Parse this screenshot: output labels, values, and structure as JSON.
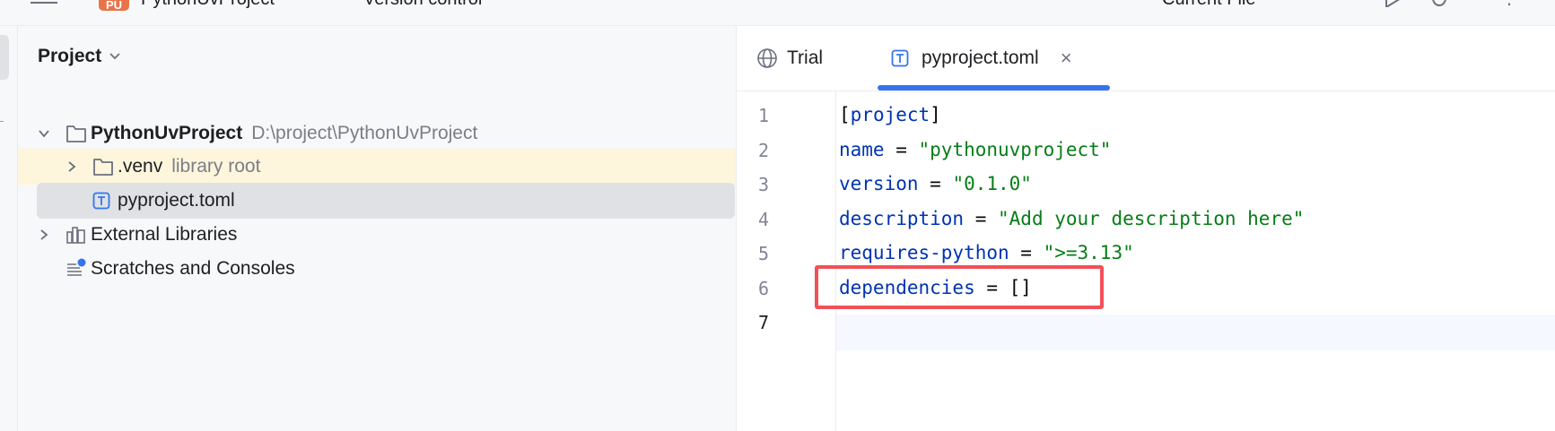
{
  "topbar": {
    "project_badge": "PU",
    "project_name": "PythonUvProject",
    "vcs_label": "Version control",
    "run_config": "Current File",
    "icons": [
      "hamburger-menu-icon",
      "run-icon",
      "debug-icon",
      "more-icon"
    ]
  },
  "project_panel": {
    "title": "Project",
    "tree": [
      {
        "name": "PythonUvProject",
        "hint": "D:\\project\\PythonUvProject",
        "type": "folder",
        "expanded": true
      },
      {
        "name": ".venv",
        "hint": "library root",
        "type": "folder",
        "expanded": false,
        "excluded": true
      },
      {
        "name": "pyproject.toml",
        "type": "toml-file",
        "selected": true
      },
      {
        "name": "External Libraries",
        "type": "libraries",
        "expanded": false
      },
      {
        "name": "Scratches and Consoles",
        "type": "scratches"
      }
    ]
  },
  "editor": {
    "tabs": [
      {
        "label": "Trial",
        "icon": "globe-icon",
        "active": false
      },
      {
        "label": "pyproject.toml",
        "icon": "toml-file-icon",
        "active": true,
        "close": "×"
      }
    ],
    "lines": [
      {
        "no": "1",
        "parts": [
          {
            "t": "[",
            "c": "p"
          },
          {
            "t": "project",
            "c": "k"
          },
          {
            "t": "]",
            "c": "p"
          }
        ]
      },
      {
        "no": "2",
        "parts": [
          {
            "t": "name",
            "c": "k"
          },
          {
            "t": " = ",
            "c": "p"
          },
          {
            "t": "\"pythonuvproject\"",
            "c": "s"
          }
        ]
      },
      {
        "no": "3",
        "parts": [
          {
            "t": "version",
            "c": "k"
          },
          {
            "t": " = ",
            "c": "p"
          },
          {
            "t": "\"0.1.0\"",
            "c": "s"
          }
        ]
      },
      {
        "no": "4",
        "parts": [
          {
            "t": "description",
            "c": "k"
          },
          {
            "t": " = ",
            "c": "p"
          },
          {
            "t": "\"Add your description here\"",
            "c": "s"
          }
        ]
      },
      {
        "no": "5",
        "parts": [
          {
            "t": "requires-python",
            "c": "k"
          },
          {
            "t": " = ",
            "c": "p"
          },
          {
            "t": "\">=3.13\"",
            "c": "s"
          }
        ]
      },
      {
        "no": "6",
        "parts": [
          {
            "t": "dependencies",
            "c": "k"
          },
          {
            "t": " = ",
            "c": "p"
          },
          {
            "t": "[]",
            "c": "p"
          }
        ]
      },
      {
        "no": "7",
        "parts": []
      }
    ],
    "highlighted_line": "6",
    "caret_line": "7"
  },
  "colors": {
    "keyword": "#0033b3",
    "string": "#067d17",
    "accent": "#3574f0",
    "highlight_box": "#f25058",
    "excluded_row": "#fdf5dc",
    "selected_row": "#dfe1e5"
  }
}
